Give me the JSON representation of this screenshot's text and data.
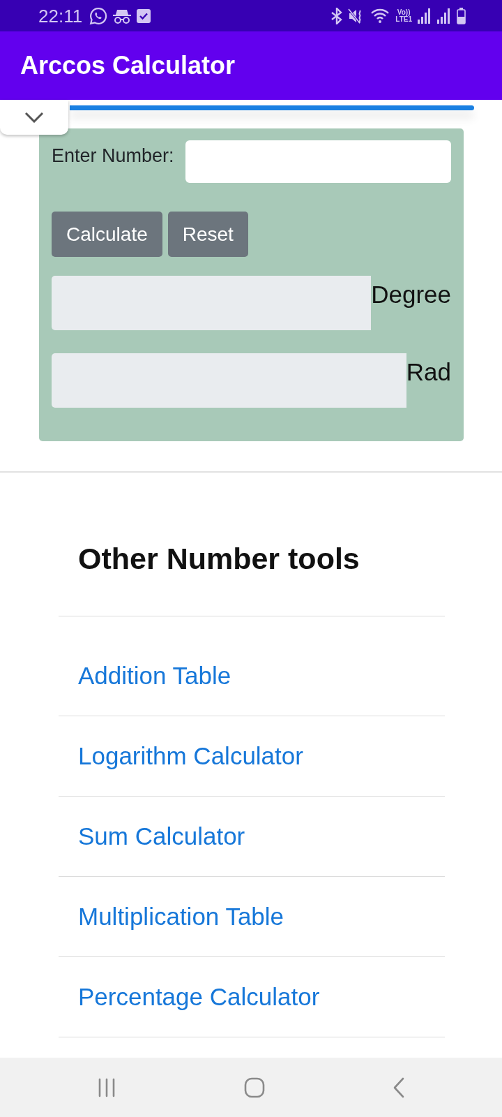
{
  "status_bar": {
    "time": "22:11",
    "network_type": [
      "Vo))",
      "LTE1"
    ]
  },
  "app_bar": {
    "title": "Arccos Calculator"
  },
  "collapse_toggle": {
    "expanded": false
  },
  "calculator": {
    "number_label": "Enter Number:",
    "buttons": [
      "Calculate",
      "Reset"
    ],
    "outputs": [
      {
        "unit": "Degree"
      },
      {
        "unit": "Rad"
      }
    ]
  },
  "other_tools": {
    "heading": "Other Number tools",
    "links": [
      "Addition Table",
      "Logarithm Calculator",
      "Sum Calculator",
      "Multiplication Table",
      "Percentage Calculator"
    ]
  }
}
